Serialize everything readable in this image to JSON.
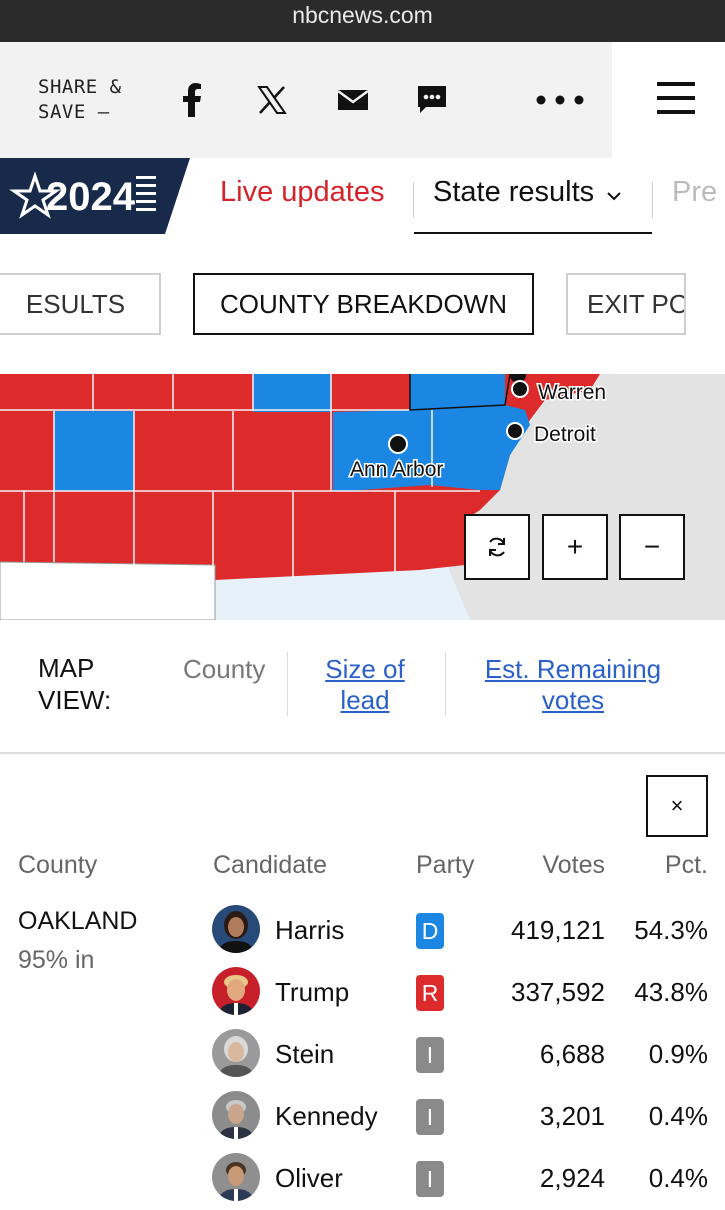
{
  "browser": {
    "url": "nbcnews.com"
  },
  "share": {
    "label_line1": "SHARE &",
    "label_line2": "SAVE —"
  },
  "logo": {
    "text": "2024"
  },
  "nav": {
    "live": "Live updates",
    "state": "State results",
    "pre": "Pre"
  },
  "tabs": [
    {
      "label": "ESULTS"
    },
    {
      "label": "COUNTY BREAKDOWN"
    },
    {
      "label": "EXIT PO"
    }
  ],
  "map": {
    "cities": [
      {
        "name": "Warren"
      },
      {
        "name": "Detroit"
      },
      {
        "name": "Ann Arbor"
      }
    ],
    "colors": {
      "dem": "#1c86e3",
      "rep": "#dd2a2a",
      "water": "#e6f1fa",
      "neighbor": "#e3e3e3"
    },
    "controls": {
      "reset": "⟳",
      "zoom_in": "+",
      "zoom_out": "−"
    }
  },
  "map_view": {
    "label_line1": "MAP",
    "label_line2": "VIEW:",
    "county": "County",
    "size_line1": "Size of",
    "size_line2": "lead",
    "est_line1": "Est. Remaining",
    "est_line2": "votes"
  },
  "close": "×",
  "table": {
    "headers": {
      "county": "County",
      "candidate": "Candidate",
      "party": "Party",
      "votes": "Votes",
      "pct": "Pct."
    },
    "county": {
      "name": "OAKLAND",
      "reporting": "95% in"
    },
    "rows": [
      {
        "candidate": "Harris",
        "party": "D",
        "votes": "419,121",
        "pct": "54.3%",
        "party_color": "#1c86e3"
      },
      {
        "candidate": "Trump",
        "party": "R",
        "votes": "337,592",
        "pct": "43.8%",
        "party_color": "#dd2a2a"
      },
      {
        "candidate": "Stein",
        "party": "I",
        "votes": "6,688",
        "pct": "0.9%",
        "party_color": "#8a8a8a"
      },
      {
        "candidate": "Kennedy",
        "party": "I",
        "votes": "3,201",
        "pct": "0.4%",
        "party_color": "#8a8a8a"
      },
      {
        "candidate": "Oliver",
        "party": "I",
        "votes": "2,924",
        "pct": "0.4%",
        "party_color": "#8a8a8a"
      }
    ]
  }
}
